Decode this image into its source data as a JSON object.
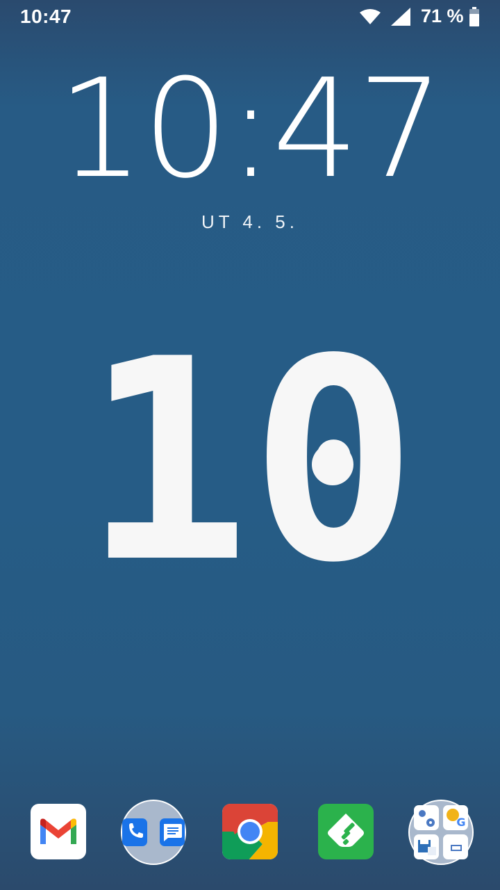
{
  "status_bar": {
    "time": "10:47",
    "battery_percent": "71 %",
    "icons": [
      "wifi-icon",
      "cell-signal-icon",
      "battery-icon"
    ]
  },
  "lock_screen": {
    "clock": "10:47",
    "date": "UT 4. 5."
  },
  "hour_widget": {
    "hour": "10"
  },
  "dock": {
    "apps": [
      {
        "name": "Gmail",
        "icon": "gmail-icon"
      },
      {
        "name": "Phone & Messages folder",
        "icon": "folder-icon"
      },
      {
        "name": "Chrome",
        "icon": "chrome-icon"
      },
      {
        "name": "Feedly",
        "icon": "feedly-icon"
      },
      {
        "name": "Tools folder",
        "icon": "folder-icon"
      }
    ]
  },
  "colors": {
    "background": "#265c86",
    "text": "#ffffff"
  }
}
